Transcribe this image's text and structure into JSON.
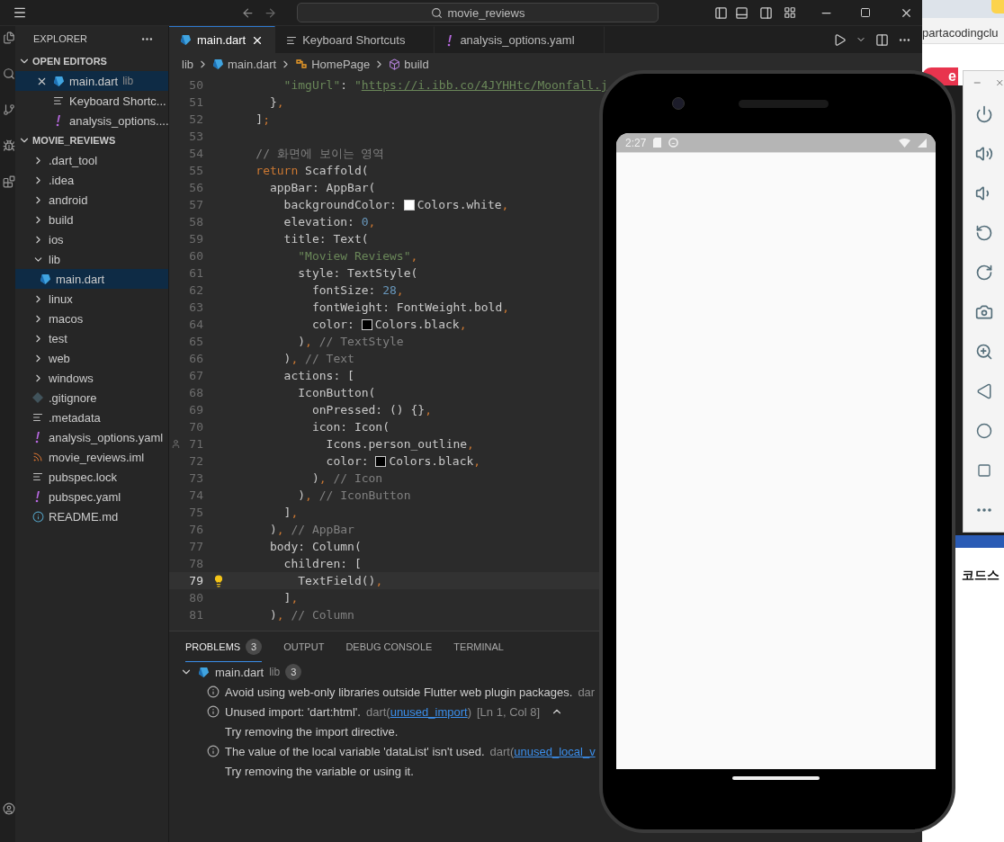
{
  "titlebar": {
    "search": "movie_reviews"
  },
  "explorer": {
    "title": "EXPLORER",
    "open_editors": {
      "title": "OPEN EDITORS",
      "expanded": true,
      "items": [
        {
          "name": "main.dart",
          "detail": "lib",
          "kind": "dart",
          "selected": true
        },
        {
          "name": "Keyboard Shortc...",
          "kind": "lines",
          "selected": false
        },
        {
          "name": "analysis_options....",
          "kind": "bang",
          "selected": false
        }
      ]
    },
    "project": {
      "title": "MOVIE_REVIEWS",
      "expanded": true,
      "items": [
        {
          "name": ".dart_tool",
          "kind": "folder",
          "expanded": false,
          "selected": false
        },
        {
          "name": ".idea",
          "kind": "folder",
          "expanded": false,
          "selected": false
        },
        {
          "name": "android",
          "kind": "folder",
          "expanded": false,
          "selected": false
        },
        {
          "name": "build",
          "kind": "folder",
          "expanded": false,
          "selected": false
        },
        {
          "name": "ios",
          "kind": "folder",
          "expanded": false,
          "selected": false
        },
        {
          "name": "lib",
          "kind": "folder",
          "expanded": true,
          "selected": false,
          "children": [
            {
              "name": "main.dart",
              "kind": "dart",
              "selected": true
            }
          ]
        },
        {
          "name": "linux",
          "kind": "folder",
          "expanded": false,
          "selected": false
        },
        {
          "name": "macos",
          "kind": "folder",
          "expanded": false,
          "selected": false
        },
        {
          "name": "test",
          "kind": "folder",
          "expanded": false,
          "selected": false
        },
        {
          "name": "web",
          "kind": "folder",
          "expanded": false,
          "selected": false
        },
        {
          "name": "windows",
          "kind": "folder",
          "expanded": false,
          "selected": false
        },
        {
          "name": ".gitignore",
          "kind": "git",
          "selected": false
        },
        {
          "name": ".metadata",
          "kind": "lines",
          "selected": false
        },
        {
          "name": "analysis_options.yaml",
          "kind": "bang",
          "selected": false
        },
        {
          "name": "movie_reviews.iml",
          "kind": "rss",
          "selected": false
        },
        {
          "name": "pubspec.lock",
          "kind": "lines",
          "selected": false
        },
        {
          "name": "pubspec.yaml",
          "kind": "bang",
          "selected": false
        },
        {
          "name": "README.md",
          "kind": "info",
          "selected": false
        }
      ]
    }
  },
  "tabs": [
    {
      "label": "main.dart",
      "kind": "dart",
      "selected": true
    },
    {
      "label": "Keyboard Shortcuts",
      "kind": "lines",
      "selected": false
    },
    {
      "label": "analysis_options.yaml",
      "kind": "bang",
      "selected": false
    }
  ],
  "breadcrumbs": [
    {
      "label": "lib",
      "kind": "folder"
    },
    {
      "label": "main.dart",
      "kind": "dart"
    },
    {
      "label": "HomePage",
      "kind": "class"
    },
    {
      "label": "build",
      "kind": "method"
    }
  ],
  "code": [
    {
      "number": "50",
      "tokens": [
        {
          "kind": "str",
          "t": "        \"imgUrl\""
        },
        {
          "kind": "text",
          "t": ": "
        },
        {
          "kind": "str",
          "t": "\""
        },
        {
          "kind": "link",
          "t": "https://i.ibb.co/4JYHHtc/Moonfall.j"
        }
      ]
    },
    {
      "number": "51",
      "tokens": [
        {
          "kind": "text",
          "t": "      }"
        },
        {
          "kind": "kw",
          "t": ","
        }
      ]
    },
    {
      "number": "52",
      "tokens": [
        {
          "kind": "text",
          "t": "    ]"
        },
        {
          "kind": "kw",
          "t": ";"
        }
      ]
    },
    {
      "number": "53"
    },
    {
      "number": "54",
      "tokens": [
        {
          "kind": "comment",
          "t": "    // 화면에 보이는 영역"
        }
      ]
    },
    {
      "number": "55",
      "tokens": [
        {
          "kind": "kw",
          "t": "    return"
        },
        {
          "kind": "text",
          "t": " Scaffold("
        }
      ]
    },
    {
      "number": "56",
      "tokens": [
        {
          "kind": "text",
          "t": "      appBar: AppBar("
        }
      ]
    },
    {
      "number": "57",
      "tokens": [
        {
          "kind": "text",
          "t": "        backgroundColor: "
        },
        {
          "kind": "swatch",
          "color": "#ffffff"
        },
        {
          "kind": "text",
          "t": "Colors.white"
        },
        {
          "kind": "kw",
          "t": ","
        }
      ]
    },
    {
      "number": "58",
      "tokens": [
        {
          "kind": "text",
          "t": "        elevation: "
        },
        {
          "kind": "num",
          "t": "0"
        },
        {
          "kind": "kw",
          "t": ","
        }
      ]
    },
    {
      "number": "59",
      "tokens": [
        {
          "kind": "text",
          "t": "        title: Text("
        }
      ]
    },
    {
      "number": "60",
      "tokens": [
        {
          "kind": "str",
          "t": "          \"Moview Reviews\""
        },
        {
          "kind": "kw",
          "t": ","
        }
      ]
    },
    {
      "number": "61",
      "tokens": [
        {
          "kind": "text",
          "t": "          style: TextStyle("
        }
      ]
    },
    {
      "number": "62",
      "tokens": [
        {
          "kind": "text",
          "t": "            fontSize: "
        },
        {
          "kind": "num",
          "t": "28"
        },
        {
          "kind": "kw",
          "t": ","
        }
      ]
    },
    {
      "number": "63",
      "tokens": [
        {
          "kind": "text",
          "t": "            fontWeight: FontWeight.bold"
        },
        {
          "kind": "kw",
          "t": ","
        }
      ]
    },
    {
      "number": "64",
      "tokens": [
        {
          "kind": "text",
          "t": "            color: "
        },
        {
          "kind": "swatch",
          "color": "#000000"
        },
        {
          "kind": "text",
          "t": "Colors.black"
        },
        {
          "kind": "kw",
          "t": ","
        }
      ]
    },
    {
      "number": "65",
      "tokens": [
        {
          "kind": "text",
          "t": "          )"
        },
        {
          "kind": "kw",
          "t": ","
        },
        {
          "kind": "comment",
          "t": " // TextStyle"
        }
      ]
    },
    {
      "number": "66",
      "tokens": [
        {
          "kind": "text",
          "t": "        )"
        },
        {
          "kind": "kw",
          "t": ","
        },
        {
          "kind": "comment",
          "t": " // Text"
        }
      ]
    },
    {
      "number": "67",
      "tokens": [
        {
          "kind": "text",
          "t": "        actions: ["
        }
      ]
    },
    {
      "number": "68",
      "tokens": [
        {
          "kind": "text",
          "t": "          IconButton("
        }
      ]
    },
    {
      "number": "69",
      "tokens": [
        {
          "kind": "text",
          "t": "            onPressed: () {}"
        },
        {
          "kind": "kw",
          "t": ","
        }
      ]
    },
    {
      "number": "70",
      "tokens": [
        {
          "kind": "text",
          "t": "            icon: Icon("
        }
      ]
    },
    {
      "number": "71",
      "kind": "person",
      "tokens": [
        {
          "kind": "text",
          "t": "              Icons.person_outline"
        },
        {
          "kind": "kw",
          "t": ","
        }
      ]
    },
    {
      "number": "72",
      "tokens": [
        {
          "kind": "text",
          "t": "              color: "
        },
        {
          "kind": "swatch",
          "color": "#000000"
        },
        {
          "kind": "text",
          "t": "Colors.black"
        },
        {
          "kind": "kw",
          "t": ","
        }
      ]
    },
    {
      "number": "73",
      "tokens": [
        {
          "kind": "text",
          "t": "            )"
        },
        {
          "kind": "kw",
          "t": ","
        },
        {
          "kind": "comment",
          "t": " // Icon"
        }
      ]
    },
    {
      "number": "74",
      "tokens": [
        {
          "kind": "text",
          "t": "          )"
        },
        {
          "kind": "kw",
          "t": ","
        },
        {
          "kind": "comment",
          "t": " // IconButton"
        }
      ]
    },
    {
      "number": "75",
      "tokens": [
        {
          "kind": "text",
          "t": "        ]"
        },
        {
          "kind": "kw",
          "t": ","
        }
      ]
    },
    {
      "number": "76",
      "tokens": [
        {
          "kind": "text",
          "t": "      )"
        },
        {
          "kind": "kw",
          "t": ","
        },
        {
          "kind": "comment",
          "t": " // AppBar"
        }
      ]
    },
    {
      "number": "77",
      "tokens": [
        {
          "kind": "text",
          "t": "      body: Column("
        }
      ]
    },
    {
      "number": "78",
      "tokens": [
        {
          "kind": "text",
          "t": "        children: ["
        }
      ]
    },
    {
      "number": "79",
      "current": true,
      "kind": "lightbulb",
      "tokens": [
        {
          "kind": "text",
          "t": "          TextField()"
        },
        {
          "kind": "kw",
          "t": ","
        }
      ]
    },
    {
      "number": "80",
      "tokens": [
        {
          "kind": "text",
          "t": "        ]"
        },
        {
          "kind": "kw",
          "t": ","
        }
      ]
    },
    {
      "number": "81",
      "tokens": [
        {
          "kind": "text",
          "t": "      )"
        },
        {
          "kind": "kw",
          "t": ","
        },
        {
          "kind": "comment",
          "t": " // Column"
        }
      ]
    }
  ],
  "panel": {
    "tabs": [
      {
        "label": "PROBLEMS",
        "count": "3",
        "selected": true
      },
      {
        "label": "OUTPUT",
        "selected": false
      },
      {
        "label": "DEBUG CONSOLE",
        "selected": false
      },
      {
        "label": "TERMINAL",
        "selected": false
      }
    ],
    "group": {
      "file": "main.dart",
      "detail": "lib",
      "count": "3",
      "expanded": true,
      "items": [
        {
          "message": "Avoid using web-only libraries outside Flutter web plugin packages.",
          "source": "dar",
          "expanded": false
        },
        {
          "message": "Unused import: 'dart:html'.",
          "source": "dart(",
          "code": "unused_import",
          "source_end": ")",
          "location": "[Ln 1, Col 8]",
          "expanded": true,
          "hint": "Try removing the import directive."
        },
        {
          "message": "The value of the local variable 'dataList' isn't used.",
          "source": "dart(",
          "code": "unused_local_v",
          "expanded": true,
          "hint": "Try removing the variable or using it."
        }
      ]
    }
  },
  "browser": {
    "address": "partacodingclu",
    "badge": "e",
    "heading": "코드스"
  },
  "phone": {
    "time": "2:27"
  }
}
